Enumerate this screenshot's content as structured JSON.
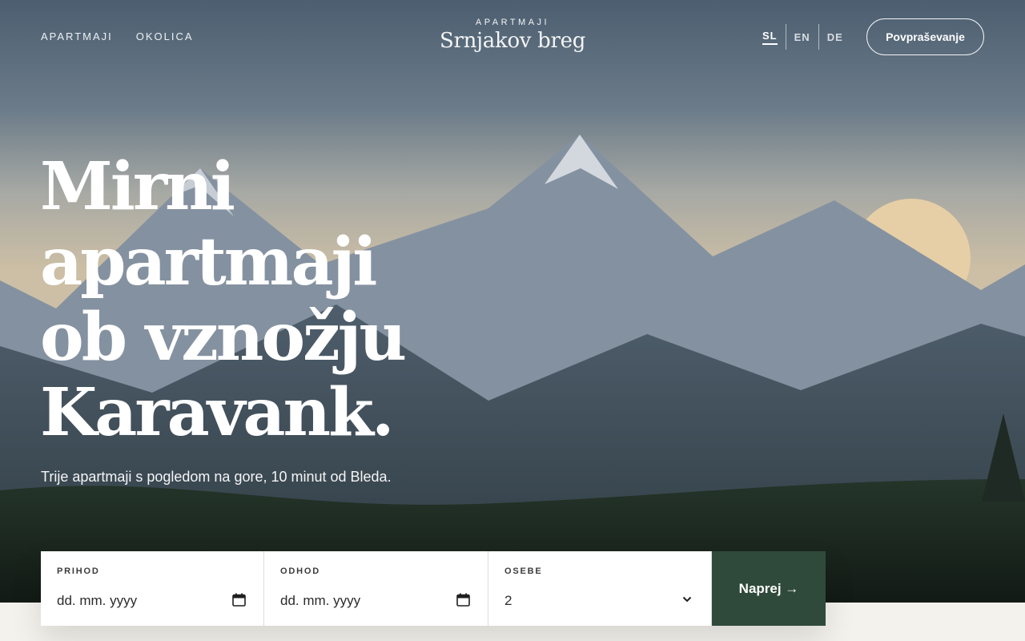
{
  "nav": {
    "links": [
      {
        "label": "APARTMAJI"
      },
      {
        "label": "OKOLICA"
      }
    ]
  },
  "brand": {
    "subtitle": "APARTMAJI",
    "name": "Srnjakov breg"
  },
  "languages": [
    {
      "code": "SL",
      "active": true
    },
    {
      "code": "EN",
      "active": false
    },
    {
      "code": "DE",
      "active": false
    }
  ],
  "cta": {
    "label": "Povpraševanje"
  },
  "hero": {
    "headline_lines": [
      "Mirni",
      "apartmaji",
      "ob vznožju",
      "Karavank."
    ],
    "tagline": "Trije apartmaji s pogledom na gore, 10 minut od Bleda."
  },
  "booking": {
    "arrival": {
      "label": "PRIHOD",
      "placeholder": "dd. mm. yyyy"
    },
    "departure": {
      "label": "ODHOD",
      "placeholder": "dd. mm. yyyy"
    },
    "guests": {
      "label": "OSEBE",
      "value": "2"
    },
    "submit_label": "Naprej →"
  },
  "colors": {
    "accent": "#2f4a3a",
    "sun": "#e6cfa6",
    "page_bg": "#f4f2ec"
  },
  "icons": {
    "date_picker": "calendar-icon",
    "guests_select": "chevron-down-icon"
  }
}
